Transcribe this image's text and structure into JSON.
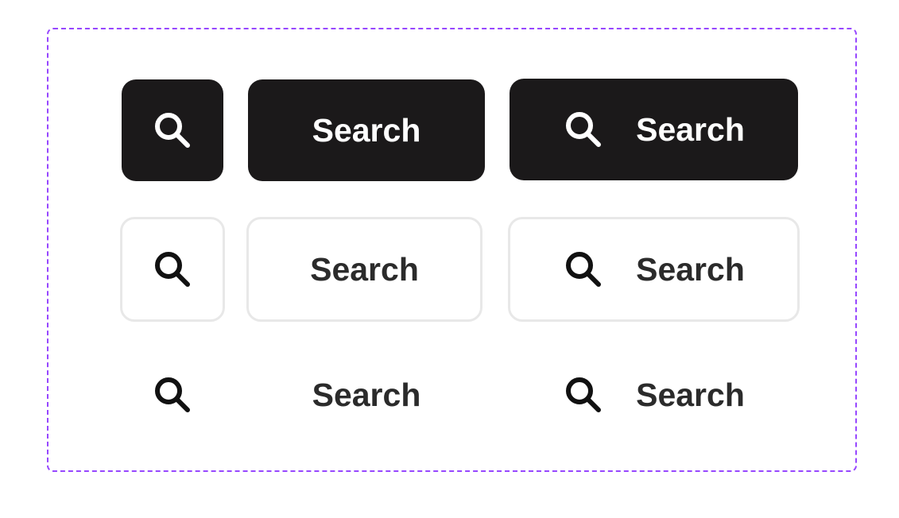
{
  "buttons": {
    "primary": {
      "icon_only": {
        "icon": "search-icon"
      },
      "text_only": {
        "label": "Search"
      },
      "icon_text": {
        "icon": "search-icon",
        "label": "Search"
      }
    },
    "outline": {
      "icon_only": {
        "icon": "search-icon"
      },
      "text_only": {
        "label": "Search"
      },
      "icon_text": {
        "icon": "search-icon",
        "label": "Search"
      }
    },
    "ghost": {
      "icon_only": {
        "icon": "search-icon"
      },
      "text_only": {
        "label": "Search"
      },
      "icon_text": {
        "icon": "search-icon",
        "label": "Search"
      }
    }
  },
  "colors": {
    "primary_bg": "#1b191a",
    "primary_text": "#ffffff",
    "outline_border": "#e8e8e8",
    "secondary_text": "#2b2b2b",
    "frame_border": "#9747ff"
  }
}
